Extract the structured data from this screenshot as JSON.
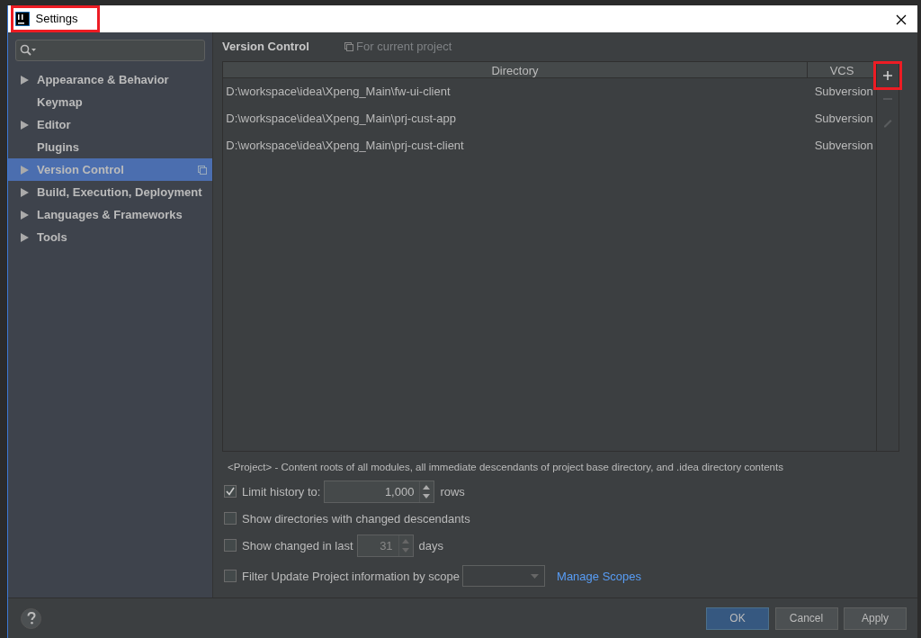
{
  "window": {
    "title": "Settings",
    "highlighted": true
  },
  "sidebar": {
    "items": [
      {
        "label": "Appearance & Behavior",
        "expandable": true,
        "selected": false,
        "project_scoped": false
      },
      {
        "label": "Keymap",
        "expandable": false,
        "selected": false,
        "project_scoped": false
      },
      {
        "label": "Editor",
        "expandable": true,
        "selected": false,
        "project_scoped": false
      },
      {
        "label": "Plugins",
        "expandable": false,
        "selected": false,
        "project_scoped": false
      },
      {
        "label": "Version Control",
        "expandable": true,
        "selected": true,
        "project_scoped": true
      },
      {
        "label": "Build, Execution, Deployment",
        "expandable": true,
        "selected": false,
        "project_scoped": false
      },
      {
        "label": "Languages & Frameworks",
        "expandable": true,
        "selected": false,
        "project_scoped": false
      },
      {
        "label": "Tools",
        "expandable": true,
        "selected": false,
        "project_scoped": false
      }
    ]
  },
  "content": {
    "title": "Version Control",
    "scope_note": "For current project"
  },
  "table": {
    "columns": [
      "Directory",
      "VCS"
    ],
    "rows": [
      {
        "directory": "D:\\workspace\\idea\\Xpeng_Main\\fw-ui-client",
        "vcs": "Subversion"
      },
      {
        "directory": "D:\\workspace\\idea\\Xpeng_Main\\prj-cust-app",
        "vcs": "Subversion"
      },
      {
        "directory": "D:\\workspace\\idea\\Xpeng_Main\\prj-cust-client",
        "vcs": "Subversion"
      }
    ],
    "tools": [
      {
        "kind": "add",
        "disabled": false,
        "highlighted": true
      },
      {
        "kind": "remove",
        "disabled": true,
        "highlighted": false
      },
      {
        "kind": "edit",
        "disabled": true,
        "highlighted": false
      }
    ]
  },
  "note": "<Project> - Content roots of all modules, all immediate descendants of project base directory, and .idea directory contents",
  "options": [
    {
      "kind": "spinner",
      "label": "Limit history to:",
      "checked": true,
      "value": "1,000",
      "suffix": "rows"
    },
    {
      "kind": "plain",
      "label": "Show directories with changed descendants",
      "checked": false
    },
    {
      "kind": "spinner",
      "label": "Show changed in last",
      "checked": false,
      "value": "31",
      "suffix": "days"
    },
    {
      "kind": "scope",
      "label": "Filter Update Project information by scope",
      "checked": false,
      "link": "Manage Scopes"
    }
  ],
  "buttons": [
    {
      "label": "OK",
      "default": true
    },
    {
      "label": "Cancel",
      "default": false
    },
    {
      "label": "Apply",
      "default": false
    }
  ]
}
